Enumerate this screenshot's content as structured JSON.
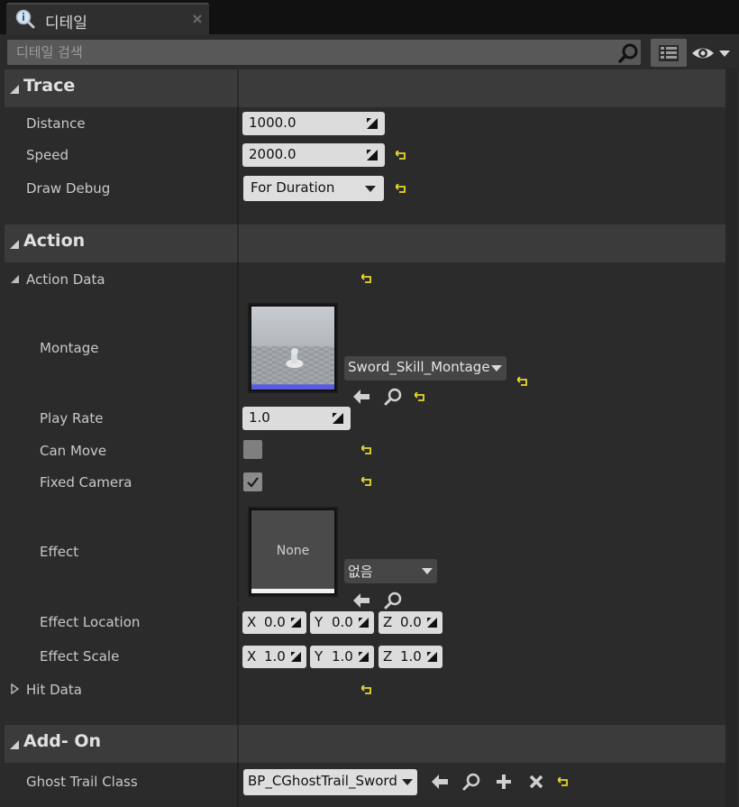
{
  "tab": {
    "title": "디테일",
    "icon": "info-magnifier-icon"
  },
  "search": {
    "placeholder": "디테일 검색",
    "value": ""
  },
  "sections": {
    "trace": {
      "title": "Trace",
      "distance": {
        "label": "Distance",
        "value": "1000.0"
      },
      "speed": {
        "label": "Speed",
        "value": "2000.0"
      },
      "draw_debug": {
        "label": "Draw Debug",
        "value": "For Duration"
      }
    },
    "action": {
      "title": "Action",
      "action_data": {
        "label": "Action Data"
      },
      "montage": {
        "label": "Montage",
        "value": "Sword_Skill_Montage"
      },
      "play_rate": {
        "label": "Play Rate",
        "value": "1.0"
      },
      "can_move": {
        "label": "Can Move",
        "checked": false
      },
      "fixed_camera": {
        "label": "Fixed Camera",
        "checked": true
      },
      "effect": {
        "label": "Effect",
        "thumb_text": "None",
        "value": "없음"
      },
      "effect_location": {
        "label": "Effect Location",
        "x_axis": "X",
        "x": "0.0",
        "y_axis": "Y",
        "y": "0.0",
        "z_axis": "Z",
        "z": "0.0"
      },
      "effect_scale": {
        "label": "Effect Scale",
        "x_axis": "X",
        "x": "1.0",
        "y_axis": "Y",
        "y": "1.0",
        "z_axis": "Z",
        "z": "1.0"
      },
      "hit_data": {
        "label": "Hit Data"
      }
    },
    "addon": {
      "title": "Add- On",
      "ghost_trail": {
        "label": "Ghost Trail Class",
        "value": "BP_CGhostTrail_Sword"
      }
    }
  },
  "colors": {
    "reset_arrow": "#e8d82a",
    "accent_bar": "#5a5ce0"
  }
}
